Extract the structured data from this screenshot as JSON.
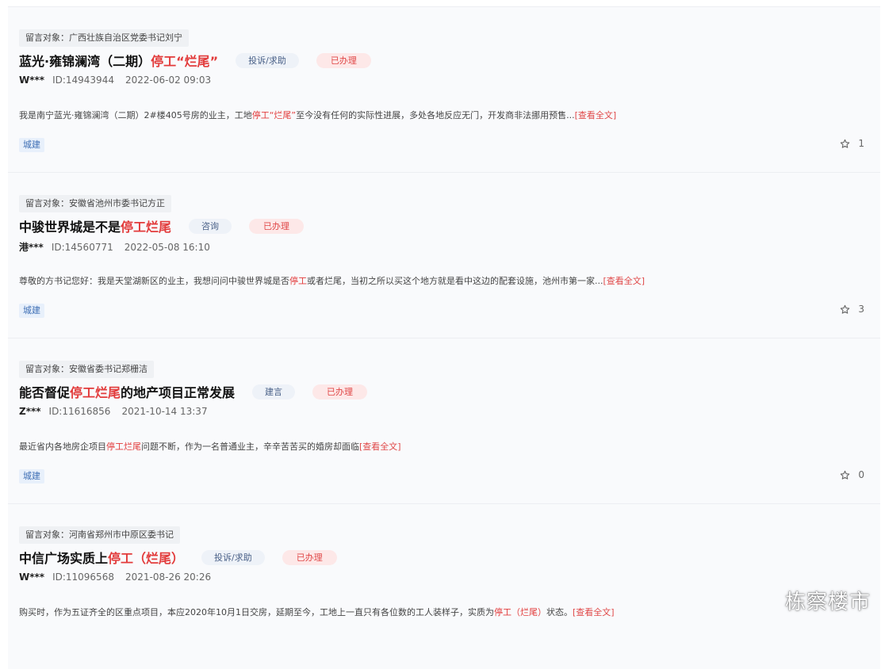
{
  "messages": [
    {
      "target": "留言对象：广西壮族自治区党委书记刘宁",
      "title_pre": "蓝光·雍锦澜湾（二期）",
      "title_hl": "停工“烂尾”",
      "title_post": "",
      "category": "投诉/求助",
      "status": "已办理",
      "user": "W***",
      "id": "ID:14943944",
      "time": "2022-06-02 09:03",
      "summary_pre": "我是南宁蓝光·雍锦澜湾（二期）2#楼405号房的业主，工地",
      "summary_hl": "停工“烂尾”",
      "summary_post": "至今没有任何的实际性进展，多处各地反应无门，开发商非法挪用预售...",
      "read_more": "[查看全文]",
      "topic": "城建",
      "favorites": "1"
    },
    {
      "target": "留言对象：安徽省池州市委书记方正",
      "title_pre": "中骏世界城是不是",
      "title_hl": "停工烂尾",
      "title_post": "",
      "category": "咨询",
      "status": "已办理",
      "user": "港***",
      "id": "ID:14560771",
      "time": "2022-05-08 16:10",
      "summary_pre": "尊敬的方书记您好：我是天堂湖新区的业主，我想问问中骏世界城是否",
      "summary_hl": "停工",
      "summary_post": "或者烂尾，当初之所以买这个地方就是看中这边的配套设施，池州市第一家...",
      "read_more": "[查看全文]",
      "topic": "城建",
      "favorites": "3"
    },
    {
      "target": "留言对象：安徽省委书记郑栅洁",
      "title_pre": "能否督促",
      "title_hl": "停工烂尾",
      "title_post": "的地产项目正常发展",
      "category": "建言",
      "status": "已办理",
      "user": "Z***",
      "id": "ID:11616856",
      "time": "2021-10-14 13:37",
      "summary_pre": "最近省内各地房企项目",
      "summary_hl": "停工烂尾",
      "summary_post": "问题不断，作为一名普通业主，辛辛苦苦买的婚房却面临",
      "read_more": "[查看全文]",
      "topic": "城建",
      "favorites": "0"
    },
    {
      "target": "留言对象：河南省郑州市中原区委书记",
      "title_pre": "中信广场实质上",
      "title_hl": "停工（烂尾）",
      "title_post": "",
      "category": "投诉/求助",
      "status": "已办理",
      "user": "W***",
      "id": "ID:11096568",
      "time": "2021-08-26 20:26",
      "summary_pre": "购买时，作为五证齐全的区重点项目，本应2020年10月1日交房，延期至今，工地上一直只有各位数的工人装样子，实质为",
      "summary_hl": "停工（烂尾）",
      "summary_post": "状态。",
      "read_more": "[查看全文]",
      "topic": "",
      "favorites": ""
    }
  ],
  "watermark": "栋察楼市",
  "colors": {
    "highlight": "#e23b3b",
    "status_bg": "#fde8e8",
    "category_bg": "#eef2f8",
    "topic_bg": "#e8f0fb"
  }
}
